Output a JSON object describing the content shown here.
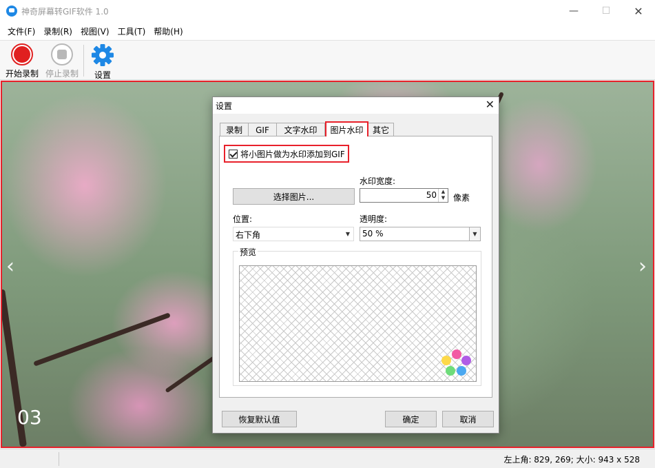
{
  "window": {
    "title": "神奇屏幕转GIF软件 1.0",
    "min_glyph": "—",
    "max_glyph": "☐",
    "close_glyph": "✕"
  },
  "menu": [
    "文件(F)",
    "录制(R)",
    "视图(V)",
    "工具(T)",
    "帮助(H)"
  ],
  "toolbar": {
    "start_label": "开始录制",
    "stop_label": "停止录制",
    "settings_label": "设置"
  },
  "capture": {
    "slide_number": "03",
    "prev_glyph": "‹",
    "next_glyph": "›",
    "border_color": "#e8202a"
  },
  "statusbar": {
    "info": "左上角: 829, 269; 大小: 943 x 528"
  },
  "dialog": {
    "title": "设置",
    "close_glyph": "✕",
    "tabs": [
      "录制",
      "GIF",
      "文字水印",
      "图片水印",
      "其它"
    ],
    "active_tab": "图片水印",
    "image_watermark": {
      "enable_label": "将小图片做为水印添加到GIF",
      "enabled": true,
      "select_image_label": "选择图片...",
      "width_label": "水印宽度:",
      "width_value": "50",
      "width_unit": "像素",
      "position_label": "位置:",
      "position_value": "右下角",
      "opacity_label": "透明度:",
      "opacity_value": "50 %",
      "preview_label": "预览",
      "logo_colors": [
        "#f25aa4",
        "#fdd94a",
        "#b05ce6",
        "#6edc7a",
        "#4aa8f0"
      ]
    },
    "buttons": {
      "restore_defaults": "恢复默认值",
      "ok": "确定",
      "cancel": "取消"
    }
  }
}
